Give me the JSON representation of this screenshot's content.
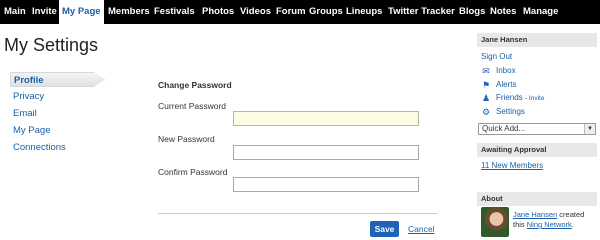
{
  "topnav": {
    "items": [
      {
        "label": "Main"
      },
      {
        "label": "Invite"
      },
      {
        "label": "My Page",
        "active": true
      },
      {
        "label": "Members"
      },
      {
        "label": "Festivals"
      },
      {
        "label": "Photos"
      },
      {
        "label": "Videos"
      },
      {
        "label": "Forum"
      },
      {
        "label": "Groups"
      },
      {
        "label": "Lineups"
      },
      {
        "label": "Twitter Tracker"
      },
      {
        "label": "Blogs"
      },
      {
        "label": "Notes"
      },
      {
        "label": "Manage"
      }
    ]
  },
  "page_title": "My Settings",
  "leftnav": {
    "items": [
      {
        "label": "Profile",
        "active": true
      },
      {
        "label": "Privacy"
      },
      {
        "label": "Email"
      },
      {
        "label": "My Page"
      },
      {
        "label": "Connections"
      }
    ]
  },
  "form": {
    "heading": "Change Password",
    "current_label": "Current Password",
    "current_value": "",
    "new_label": "New Password",
    "new_value": "",
    "confirm_label": "Confirm Password",
    "confirm_value": "",
    "save_label": "Save",
    "cancel_label": "Cancel"
  },
  "user_panel": {
    "name": "Jane Hansen",
    "sign_out": "Sign Out",
    "inbox": "Inbox",
    "alerts": "Alerts",
    "friends": "Friends",
    "invite": "- Invite",
    "settings": "Settings",
    "quick_add": "Quick Add..."
  },
  "approval_panel": {
    "title": "Awaiting Approval",
    "link": "11 New Members"
  },
  "about_panel": {
    "title": "About",
    "user_link": "Jane Hansen",
    "created_text": " created",
    "this_text": "this ",
    "network_link": "Ning Network",
    "period": "."
  },
  "colors": {
    "nav_background": "#000000",
    "link_blue": "#1a5fa8",
    "button_blue": "#1f62b7",
    "focused_field": "#fcfce3"
  }
}
